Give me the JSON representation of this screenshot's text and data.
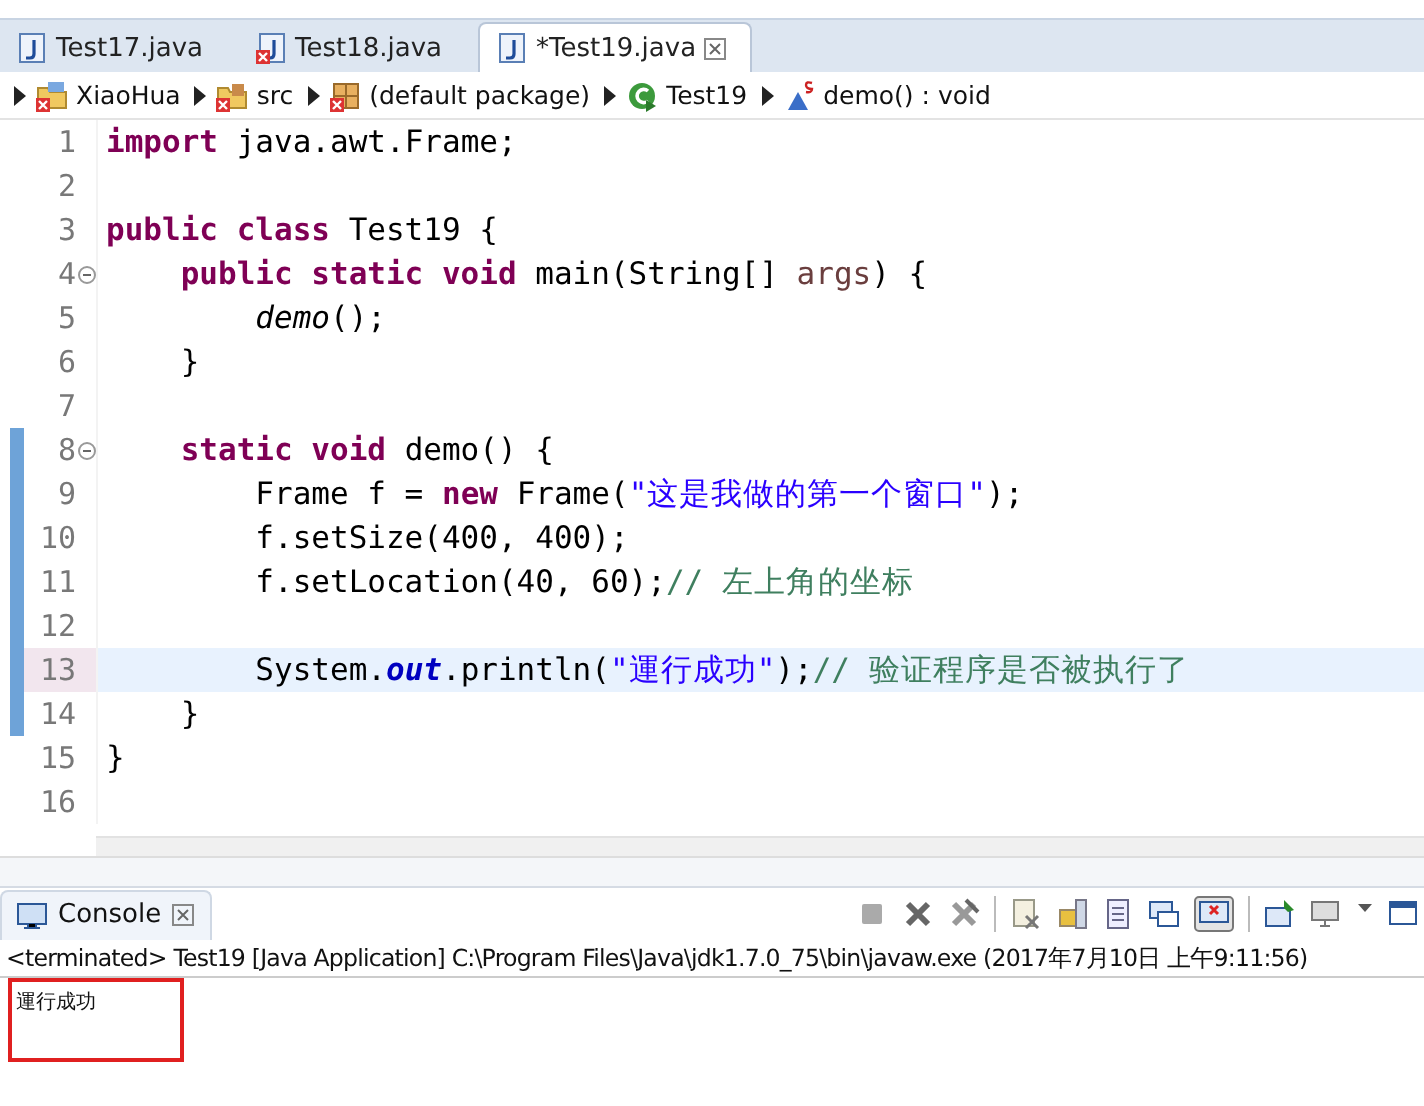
{
  "editor_tabs": [
    {
      "label": "Test17.java",
      "selected": false,
      "error": false
    },
    {
      "label": "Test18.java",
      "selected": false,
      "error": true
    },
    {
      "label": "*Test19.java",
      "selected": true,
      "error": false
    }
  ],
  "breadcrumb": [
    {
      "kind": "project",
      "label": "XiaoHua",
      "error": true
    },
    {
      "kind": "source-folder",
      "label": "src",
      "error": true
    },
    {
      "kind": "package",
      "label": "(default package)",
      "error": true
    },
    {
      "kind": "class",
      "label": "Test19",
      "error": false
    },
    {
      "kind": "method",
      "label": "demo() : void",
      "error": false
    }
  ],
  "code_lines": [
    {
      "number": "1",
      "selected": false,
      "changed": false,
      "foldable": false,
      "tokens": [
        {
          "kind": "keyword",
          "text": "import"
        },
        {
          "kind": "plain",
          "text": " java.awt.Frame;"
        }
      ]
    },
    {
      "number": "2",
      "selected": false,
      "changed": false,
      "foldable": false
    },
    {
      "number": "3",
      "selected": false,
      "changed": false,
      "foldable": false,
      "tokens": [
        {
          "kind": "keyword",
          "text": "public class"
        },
        {
          "kind": "plain",
          "text": " Test19 {"
        }
      ]
    },
    {
      "number": "4",
      "selected": false,
      "changed": false,
      "foldable": true,
      "tokens": [
        {
          "kind": "keyword",
          "text": "    public static void"
        },
        {
          "kind": "plain",
          "text": " main(String[] "
        },
        {
          "kind": "param",
          "text": "args"
        },
        {
          "kind": "plain",
          "text": ") {"
        }
      ]
    },
    {
      "number": "5",
      "selected": false,
      "changed": false,
      "foldable": false,
      "tokens": [
        {
          "kind": "static-call",
          "text": "        demo"
        },
        {
          "kind": "plain",
          "text": "();"
        }
      ]
    },
    {
      "number": "6",
      "selected": false,
      "changed": false,
      "foldable": false,
      "tokens": [
        {
          "kind": "plain",
          "text": "    }"
        }
      ]
    },
    {
      "number": "7",
      "selected": false,
      "changed": false,
      "foldable": false
    },
    {
      "number": "8",
      "selected": false,
      "changed": true,
      "foldable": true,
      "tokens": [
        {
          "kind": "keyword",
          "text": "    static void"
        },
        {
          "kind": "plain",
          "text": " demo() {"
        }
      ]
    },
    {
      "number": "9",
      "selected": false,
      "changed": true,
      "foldable": false,
      "tokens": [
        {
          "kind": "plain",
          "text": "        Frame f = "
        },
        {
          "kind": "keyword",
          "text": "new"
        },
        {
          "kind": "plain",
          "text": " Frame("
        },
        {
          "kind": "string",
          "text": "\"这是我做的第一个窗口\""
        },
        {
          "kind": "plain",
          "text": ");"
        }
      ]
    },
    {
      "number": "10",
      "selected": false,
      "changed": true,
      "foldable": false,
      "tokens": [
        {
          "kind": "plain",
          "text": "        f.setSize(400, 400);"
        }
      ]
    },
    {
      "number": "11",
      "selected": false,
      "changed": true,
      "foldable": false,
      "tokens": [
        {
          "kind": "plain",
          "text": "        f.setLocation(40, 60);"
        },
        {
          "kind": "comment",
          "text": "// 左上角的坐标"
        }
      ]
    },
    {
      "number": "12",
      "selected": false,
      "changed": true,
      "foldable": false
    },
    {
      "number": "13",
      "selected": true,
      "changed": true,
      "foldable": false,
      "tokens": [
        {
          "kind": "plain",
          "text": "        System."
        },
        {
          "kind": "static-field",
          "text": "out"
        },
        {
          "kind": "plain",
          "text": ".println("
        },
        {
          "kind": "string",
          "text": "\"運行成功\""
        },
        {
          "kind": "plain",
          "text": ");"
        },
        {
          "kind": "comment",
          "text": "// 验证程序是否被执行了"
        }
      ]
    },
    {
      "number": "14",
      "selected": false,
      "changed": true,
      "foldable": false,
      "tokens": [
        {
          "kind": "plain",
          "text": "    }"
        }
      ]
    },
    {
      "number": "15",
      "selected": false,
      "changed": false,
      "foldable": false,
      "tokens": [
        {
          "kind": "plain",
          "text": "}"
        }
      ]
    },
    {
      "number": "16",
      "selected": false,
      "changed": false,
      "foldable": false
    }
  ],
  "console": {
    "tab_label": "Console",
    "status": "<terminated> Test19 [Java Application] C:\\Program Files\\Java\\jdk1.7.0_75\\bin\\javaw.exe (2017年7月10日 上午9:11:56)",
    "output": "運行成功",
    "output_marked": true
  }
}
